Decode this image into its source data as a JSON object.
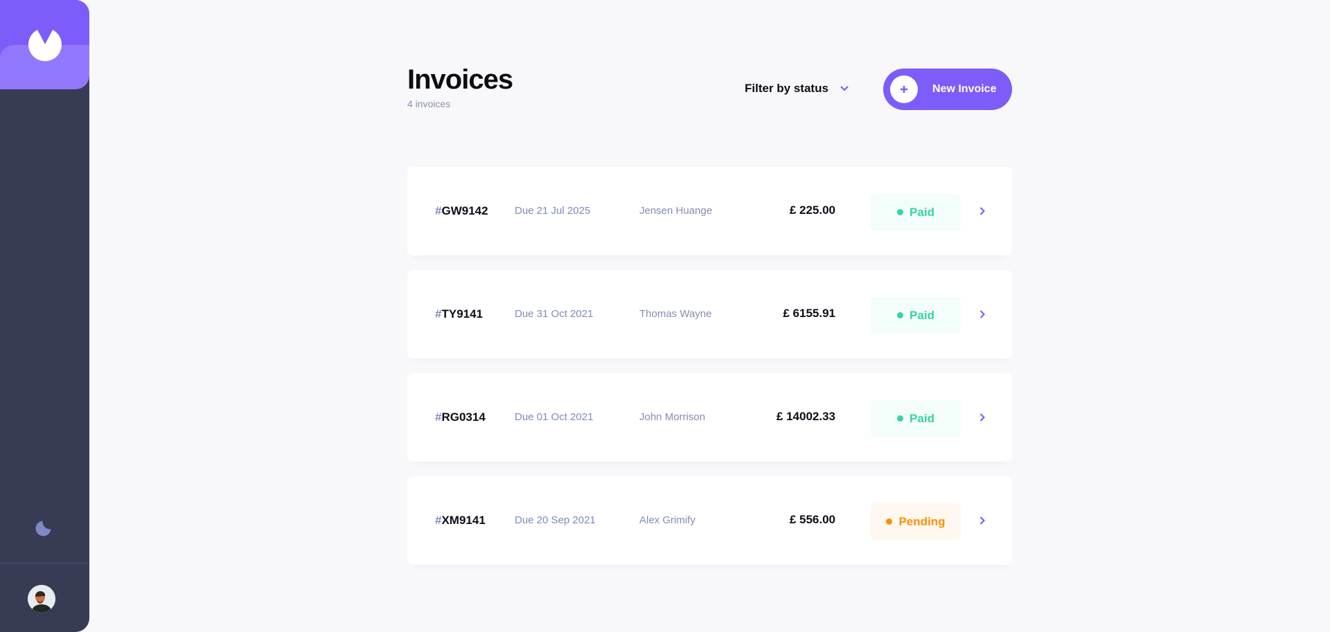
{
  "header": {
    "title": "Invoices",
    "count_text": "4 invoices",
    "filter_label": "Filter by status",
    "new_button_label": "New Invoice"
  },
  "invoices": [
    {
      "prefix": "#",
      "id": "GW9142",
      "due": "Due 21 Jul 2025",
      "client": "Jensen Huange",
      "amount": "£ 225.00",
      "status": "Paid"
    },
    {
      "prefix": "#",
      "id": "TY9141",
      "due": "Due 31 Oct 2021",
      "client": "Thomas Wayne",
      "amount": "£ 6155.91",
      "status": "Paid"
    },
    {
      "prefix": "#",
      "id": "RG0314",
      "due": "Due 01 Oct 2021",
      "client": "John Morrison",
      "amount": "£ 14002.33",
      "status": "Paid"
    },
    {
      "prefix": "#",
      "id": "XM9141",
      "due": "Due 20 Sep 2021",
      "client": "Alex Grimify",
      "amount": "£ 556.00",
      "status": "Pending"
    }
  ],
  "sidebar": {
    "logo_icon": "app-logo-icon",
    "theme_icon": "moon-icon",
    "avatar": "user-avatar"
  },
  "colors": {
    "accent": "#7c5dfa",
    "sidebar": "#373b53",
    "paid": "#33d69f",
    "pending": "#ff8f00"
  }
}
